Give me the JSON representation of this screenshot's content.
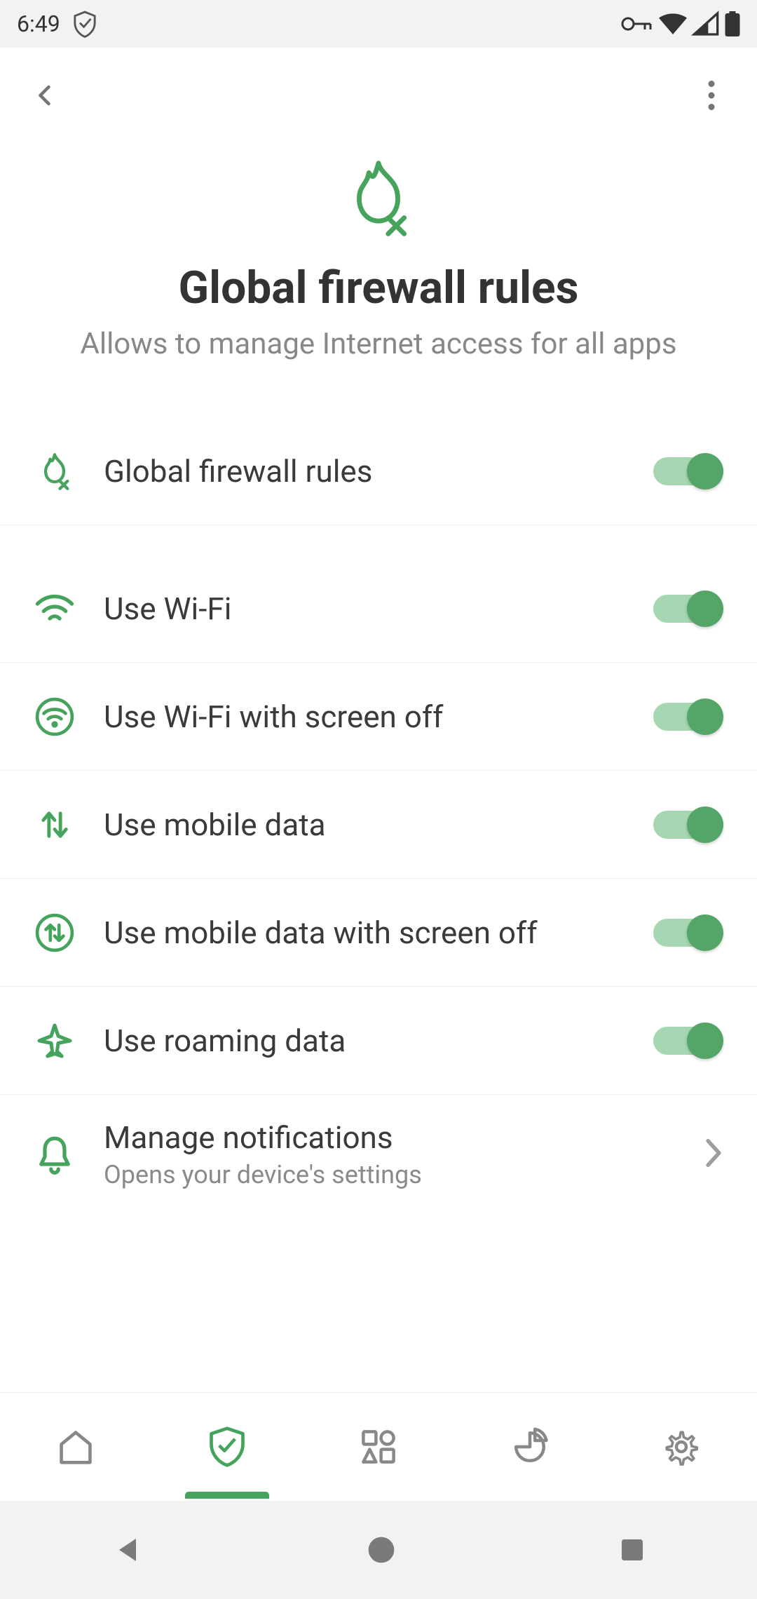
{
  "status": {
    "time": "6:49"
  },
  "header": {
    "title": "Global firewall rules",
    "subtitle": "Allows to manage Internet access for all apps"
  },
  "rows": {
    "global": {
      "label": "Global firewall rules",
      "on": true
    },
    "wifi": {
      "label": "Use Wi-Fi",
      "on": true
    },
    "wifi_off": {
      "label": "Use Wi-Fi with screen off",
      "on": true
    },
    "mobile": {
      "label": "Use mobile data",
      "on": true
    },
    "mobile_off": {
      "label": "Use mobile data with screen off",
      "on": true
    },
    "roaming": {
      "label": "Use roaming data",
      "on": true
    },
    "notif": {
      "label": "Manage notifications",
      "sub": "Opens your device's settings"
    }
  },
  "colors": {
    "accent": "#45a35c",
    "grey": "#888888"
  }
}
